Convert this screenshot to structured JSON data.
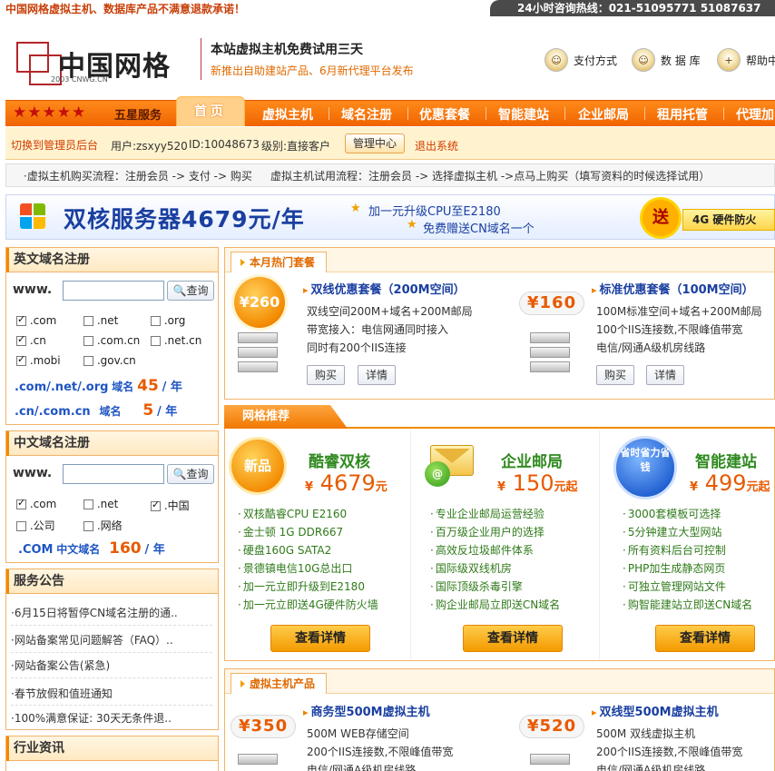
{
  "top": {
    "slogan": "中国网格虚拟主机、数据库产品不满意退款承诺！",
    "hotline": "24小时咨询热线：021-51095771 51087637"
  },
  "header": {
    "logo_text": "中国网格",
    "logo_sub": "2003 CNWG.CN",
    "promo_title": "本站虚拟主机免费试用三天",
    "promo_sub": "新推出自助建站产品、6月新代理平台发布",
    "links": [
      {
        "label": "支付方式",
        "icon": "payment-icon"
      },
      {
        "label": "数 据 库",
        "icon": "database-icon"
      },
      {
        "label": "帮助中",
        "icon": "help-icon"
      }
    ]
  },
  "nav": {
    "stars": "★★★★★",
    "five_star": "五星服务",
    "home": "首页",
    "items": [
      "虚拟主机",
      "域名注册",
      "优惠套餐",
      "智能建站",
      "企业邮局",
      "租用托管",
      "代理加"
    ]
  },
  "userbar": {
    "switch": "切换到管理员后台",
    "user": "用户:zsxyy520",
    "id": "ID:10048673",
    "level": "级别:直接客户",
    "manage": "管理中心",
    "logout": "退出系统"
  },
  "flow": {
    "buy": "·虚拟主机购买流程：注册会员 -> 支付 -> 购买",
    "trial": "虚拟主机试用流程：注册会员 -> 选择虚拟主机 ->点马上购买（填写资料的时候选择试用）"
  },
  "banner": {
    "title": "双核服务器4679元/年",
    "line1": "加一元升级CPU至E2180",
    "line2": "免费赠送CN域名一个",
    "gift_char": "送",
    "gift_text": "4G 硬件防火"
  },
  "en_domain": {
    "title": "英文域名注册",
    "www": "www.",
    "search": "查询",
    "search_value": "",
    "options": [
      {
        "label": ".com",
        "checked": true
      },
      {
        "label": ".net",
        "checked": false
      },
      {
        "label": ".org",
        "checked": false
      },
      {
        "label": ".cn",
        "checked": true
      },
      {
        "label": ".com.cn",
        "checked": false
      },
      {
        "label": ".net.cn",
        "checked": false
      },
      {
        "label": ".mobi",
        "checked": true
      },
      {
        "label": ".gov.cn",
        "checked": false
      }
    ],
    "price1": {
      "ext": ".com/.net/.org",
      "tag": "域名",
      "price": "45",
      "unit": "/ 年"
    },
    "price2": {
      "ext": ".cn/.com.cn",
      "tag": "域名",
      "price": "5",
      "unit": "/ 年"
    }
  },
  "cn_domain": {
    "title": "中文域名注册",
    "www": "www.",
    "search": "查询",
    "search_value": "",
    "options": [
      {
        "label": ".com",
        "checked": true
      },
      {
        "label": ".net",
        "checked": false
      },
      {
        "label": ".中国",
        "checked": true
      },
      {
        "label": ".公司",
        "checked": false
      },
      {
        "label": ".网络",
        "checked": false
      }
    ],
    "price": {
      "ext": ".COM",
      "tag": "中文域名",
      "price": "160",
      "unit": "/ 年"
    }
  },
  "notices": {
    "title": "服务公告",
    "items": [
      "·6月15日将暂停CN域名注册的通..",
      "·网站备案常见问题解答（FAQ）..",
      "·网站备案公告(紧急)",
      "·春节放假和值班通知",
      "·100%满意保证: 30天无条件退.."
    ]
  },
  "industry": {
    "title": "行业资讯"
  },
  "hot": {
    "tab": "本月热门套餐",
    "packages": [
      {
        "badge": "¥260",
        "title": "双线优惠套餐（200M空间）",
        "lines": [
          "双线空间200M+域名+200M邮局",
          "带宽接入：电信网通同时接入",
          "同时有200个IIS连接"
        ],
        "buy": "购买",
        "detail": "详情"
      },
      {
        "badge": "¥160",
        "title": "标准优惠套餐（100M空间）",
        "lines": [
          "100M标准空间+域名+200M邮局",
          "100个IIS连接数,不限峰值带宽",
          "电信/网通A级机房线路"
        ],
        "buy": "购买",
        "detail": "详情"
      }
    ]
  },
  "recommend": {
    "tab": "网格推荐",
    "items": [
      {
        "badge": "新品",
        "name": "酷睿双核",
        "currency": "¥",
        "price": "4679",
        "unit": "元",
        "features": [
          "双核酷睿CPU E2160",
          "金士顿 1G DDR667",
          "硬盘160G SATA2",
          "景德镇电信10G总出口",
          "加一元立即升级到E2180",
          "加一元立即送4G硬件防火墙"
        ],
        "button": "查看详情"
      },
      {
        "badge": "",
        "name": "企业邮局",
        "currency": "¥",
        "price": "150",
        "unit": "元起",
        "features": [
          "专业企业邮局运营经验",
          "百万级企业用户的选择",
          "高效反垃圾邮件体系",
          "国际级双线机房",
          "国际顶级杀毒引擎",
          "购企业邮局立即送CN域名"
        ],
        "button": "查看详情"
      },
      {
        "badge": "省时省力省钱",
        "name": "智能建站",
        "currency": "¥",
        "price": "499",
        "unit": "元起",
        "features": [
          "3000套模板可选择",
          "5分钟建立大型网站",
          "所有资料后台可控制",
          "PHP加生成静态网页",
          "可独立管理网站文件",
          "购智能建站立即送CN域名"
        ],
        "button": "查看详情"
      }
    ]
  },
  "vhost": {
    "tab": "虚拟主机产品",
    "items": [
      {
        "badge": "¥350",
        "title": "商务型500M虚拟主机",
        "lines": [
          "500M WEB存储空间",
          "200个IIS连接数,不限峰值带宽",
          "电信/网通A级机房线路"
        ]
      },
      {
        "badge": "¥520",
        "title": "双线型500M虚拟主机",
        "lines": [
          "500M 双线虚拟主机",
          "200个IIS连接数,不限峰值带宽",
          "电信/网通A级机房线路"
        ]
      }
    ]
  },
  "colors": {
    "brand_orange": "#f07800",
    "title_blue": "#1a3fa0",
    "price_orange": "#e85a00",
    "green": "#2f8a1f"
  }
}
